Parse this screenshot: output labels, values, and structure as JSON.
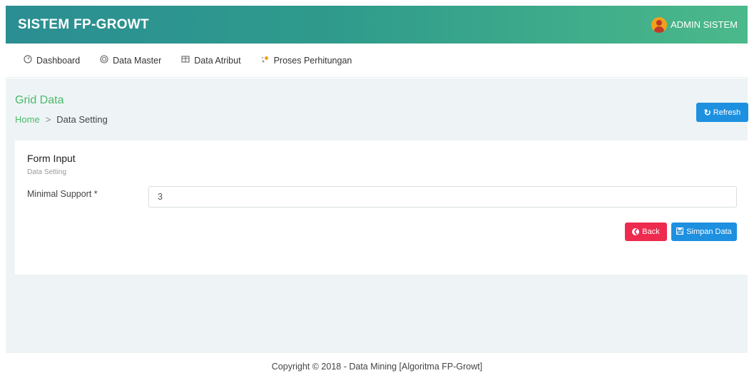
{
  "header": {
    "brand": "SISTEM FP-GROWT",
    "user_name": "ADMIN SISTEM"
  },
  "nav": {
    "items": [
      {
        "label": "Dashboard",
        "icon": "dashboard-icon"
      },
      {
        "label": "Data Master",
        "icon": "target-icon"
      },
      {
        "label": "Data Atribut",
        "icon": "table-icon"
      },
      {
        "label": "Proses Perhitungan",
        "icon": "process-icon"
      }
    ]
  },
  "page": {
    "title": "Grid Data",
    "breadcrumb_home": "Home",
    "breadcrumb_sep": ">",
    "breadcrumb_current": "Data Setting",
    "refresh_label": "Refresh"
  },
  "form": {
    "title": "Form Input",
    "subtitle": "Data Setting",
    "min_support_label": "Minimal Support *",
    "min_support_value": "3",
    "back_label": "Back",
    "save_label": "Simpan Data"
  },
  "footer": {
    "text": "Copyright © 2018 - Data Mining [Algoritma FP-Growt]"
  },
  "colors": {
    "header_start": "#2b8e93",
    "header_end": "#4bb98a",
    "accent_green": "#4cb96b",
    "primary_blue": "#1e90e0",
    "danger_red": "#ee2a4e",
    "content_bg": "#eef4f5"
  }
}
